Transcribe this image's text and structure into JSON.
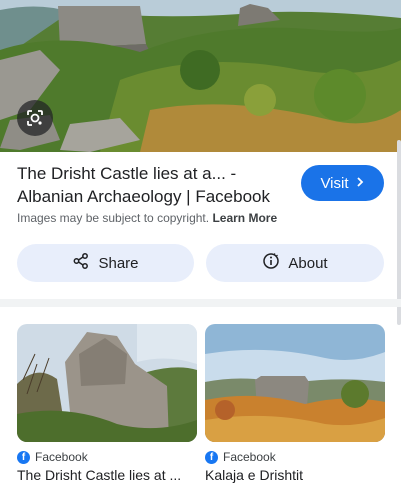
{
  "result": {
    "title": "The Drisht Castle lies at a... - Albanian Archaeology | Facebook",
    "visit_label": "Visit",
    "copyright_text": "Images may be subject to copyright.",
    "learn_more_label": "Learn More",
    "share_label": "Share",
    "about_label": "About"
  },
  "related": [
    {
      "source": "Facebook",
      "title": "The Drisht Castle lies at ..."
    },
    {
      "source": "Facebook",
      "title": "Kalaja e Drishtit"
    }
  ],
  "colors": {
    "accent": "#1a73e8",
    "pill_bg": "#e8eefb",
    "facebook_blue": "#1877f2"
  },
  "icons": {
    "lens": "lens-search-icon",
    "visit": "chevron-right-icon",
    "share": "share-icon",
    "about": "info-icon",
    "source": "facebook-icon"
  }
}
